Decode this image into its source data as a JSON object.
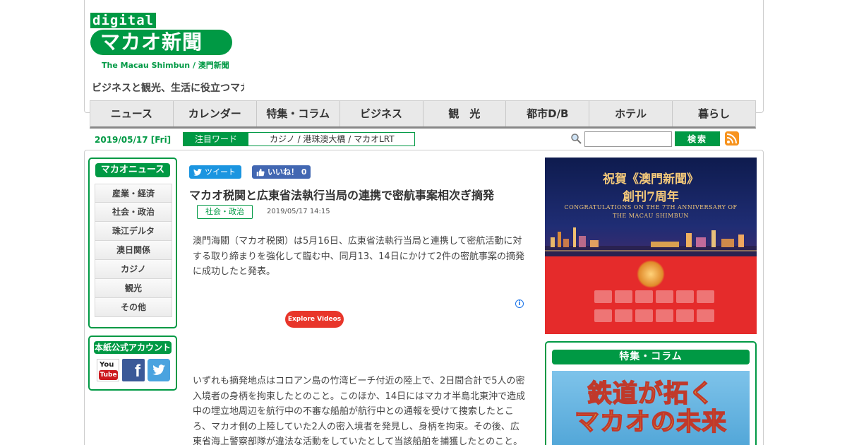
{
  "header": {
    "logo_digital": "digital",
    "logo_main": "マカオ新聞",
    "logo_sub": "The Macau Shimbun / 澳門新聞",
    "tagline": "ビジネスと観光、生活に役立つマカオ"
  },
  "nav": [
    {
      "label": "ニュース"
    },
    {
      "label": "カレンダー"
    },
    {
      "label": "特集・コラム"
    },
    {
      "label": "ビジネス"
    },
    {
      "label": "観　光"
    },
    {
      "label": "都市D/B"
    },
    {
      "label": "ホテル"
    },
    {
      "label": "暮らし"
    }
  ],
  "infobar": {
    "date": "2019/05/17 [Fri]",
    "hot_label": "注目ワード",
    "hot_words": "カジノ / 港珠澳大橋 / マカオLRT",
    "search_placeholder": "",
    "search_button": "検索"
  },
  "sidebar": {
    "news_title": "マカオニュース",
    "categories": [
      {
        "label": "産業・経済"
      },
      {
        "label": "社会・政治"
      },
      {
        "label": "珠江デルタ"
      },
      {
        "label": "澳日関係"
      },
      {
        "label": "カジノ"
      },
      {
        "label": "観光"
      },
      {
        "label": "その他"
      }
    ],
    "account_title": "本紙公式アカウント",
    "youtube_top": "You",
    "youtube_bottom": "Tube",
    "facebook_glyph": "f"
  },
  "article": {
    "tweet_label": "ツイート",
    "like_label": "いいね！ 0",
    "title": "マカオ税関と広東省法執行当局の連携で密航事案相次ぎ摘発",
    "category": "社会・政治",
    "published": "2019/05/17 14:15",
    "paragraph1": "澳門海關（マカオ税関）は5月16日、広東省法執行当局と連携して密航活動に対する取り締まりを強化して臨む中、同月13、14日にかけて2件の密航事案の摘発に成功したと発表。",
    "video_button": "Explore Videos",
    "ad_info": "i",
    "paragraph2": "いずれも摘発地点はコロアン島の竹湾ビーチ付近の陸上で、2日間合計で5人の密入境者の身柄を拘束したとのこと。このほか、14日にはマカオ半島北東沖で造成中の埋立地周辺を航行中の不審な船舶が航行中との通報を受けて捜索したところ、マカオ側の上陸していた2人の密入境者を発見し、身柄を拘束。その後、広東省海上警察部隊が違法な活動をしていたとして当該船舶を捕獲したとのこと。"
  },
  "ad": {
    "line1": "祝賀《澳門新聞》",
    "line2": "創刊7周年",
    "line3": "CONGRATULATIONS ON THE 7TH ANNIVERSARY OF",
    "line4": "THE MACAU SHIMBUN"
  },
  "feature": {
    "title": "特集・コラム",
    "line1": "鉄道が拓く",
    "line2": "マカオの未来"
  }
}
